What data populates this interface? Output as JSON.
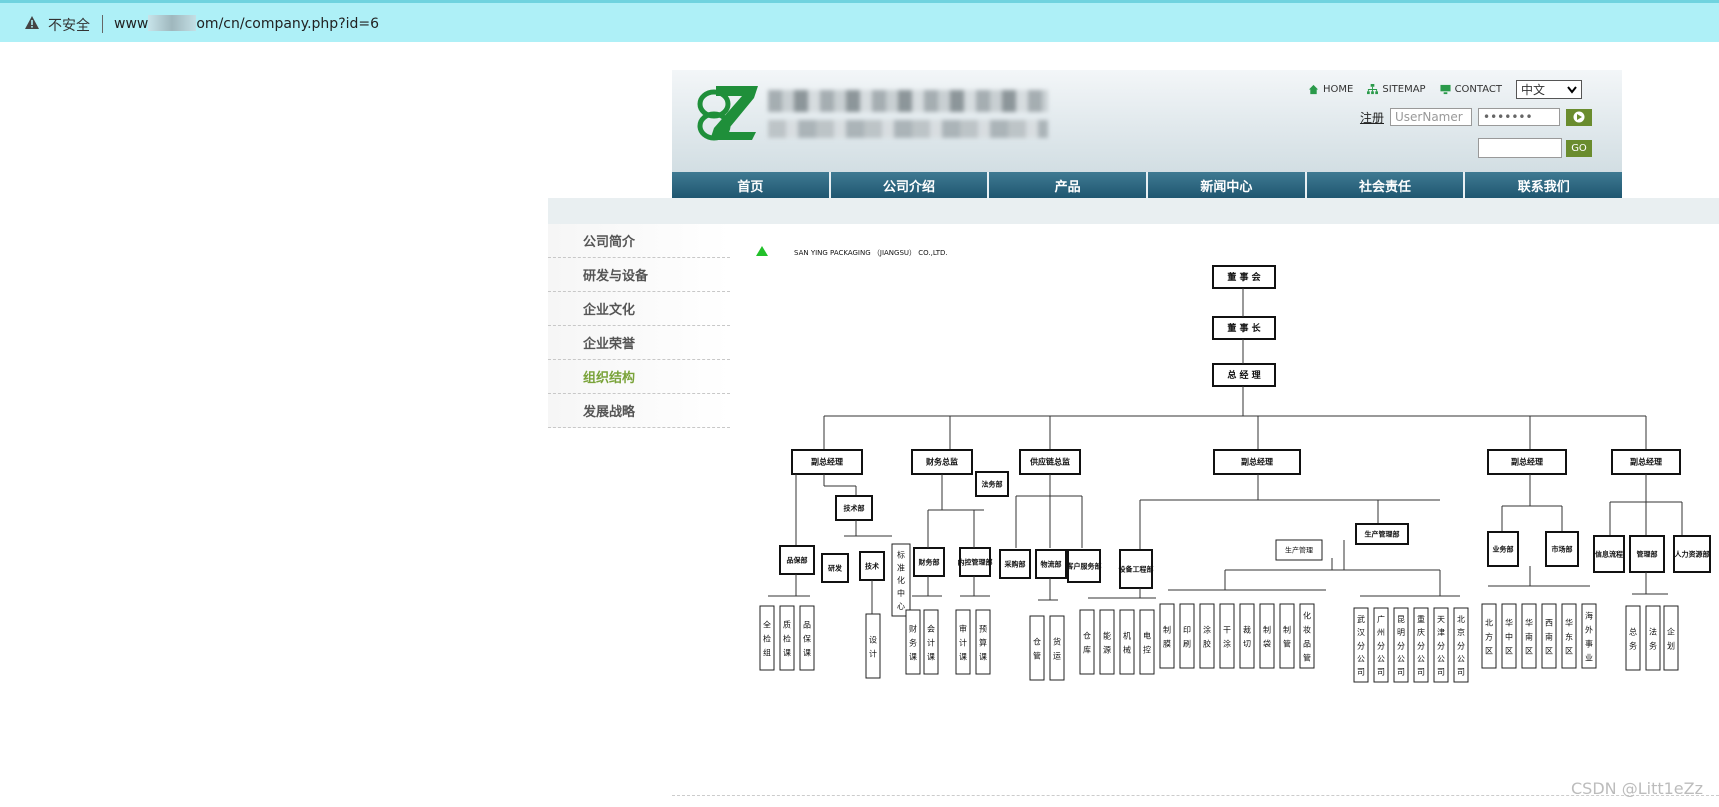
{
  "browser": {
    "insecure_label": "不安全",
    "url_prefix": "www",
    "url_suffix": "om/cn/company.php?id=6"
  },
  "header": {
    "links": [
      {
        "label": "HOME",
        "icon": "home-icon"
      },
      {
        "label": "SITEMAP",
        "icon": "sitemap-icon"
      },
      {
        "label": "CONTACT",
        "icon": "monitor-icon"
      }
    ],
    "lang_selected": "中文",
    "register": "注册",
    "username_placeholder": "UserNamer",
    "password_value": "•••••••",
    "go_label": "GO"
  },
  "nav": [
    "首页",
    "公司介绍",
    "产品",
    "新闻中心",
    "社会责任",
    "联系我们"
  ],
  "sidebar": [
    "公司简介",
    "研发与设备",
    "企业文化",
    "企业荣誉",
    "组织结构",
    "发展战略"
  ],
  "sidebar_active_index": 4,
  "chart_title": "SAN YING PACKAGING （JIANGSU） CO.,LTD.",
  "org": {
    "top": [
      "董 事 会",
      "董 事 长",
      "总 经 理"
    ],
    "level1": [
      "副总经理",
      "财务总监",
      "供应链总监",
      "副总经理",
      "副总经理",
      "副总经理"
    ],
    "mid": [
      "技术部",
      "法务部",
      "品保部",
      "研发",
      "技术",
      "标准化中心",
      "财务部",
      "内控管理部",
      "采购部",
      "物流部",
      "客户服务部",
      "设备工程部",
      "生产管理部",
      "生产管理",
      "业务部",
      "市场部",
      "信息流程",
      "管理部",
      "人力资源部"
    ],
    "leaves": [
      "全检组",
      "质检课",
      "品保课",
      "设计",
      "财务课",
      "会计课",
      "审计课",
      "预算课",
      "仓管",
      "货运",
      "仓库",
      "能源",
      "机械",
      "电控",
      "制膜",
      "印刷",
      "涂胶",
      "干涂",
      "裁切",
      "制袋",
      "制管",
      "化妆品管",
      "武汉分公司",
      "广州分公司",
      "昆明分公司",
      "重庆分公司",
      "天津分公司",
      "北京分公司",
      "北方区",
      "华中区",
      "华南区",
      "西南区",
      "华东区",
      "海外事业",
      "总务",
      "法务",
      "企划"
    ]
  },
  "watermark": "CSDN @Litt1eZz",
  "colors": {
    "nav": "#1f5670",
    "accent": "#7aa33a",
    "go": "#6a8c2e",
    "addrbar": "#aef0f7"
  }
}
